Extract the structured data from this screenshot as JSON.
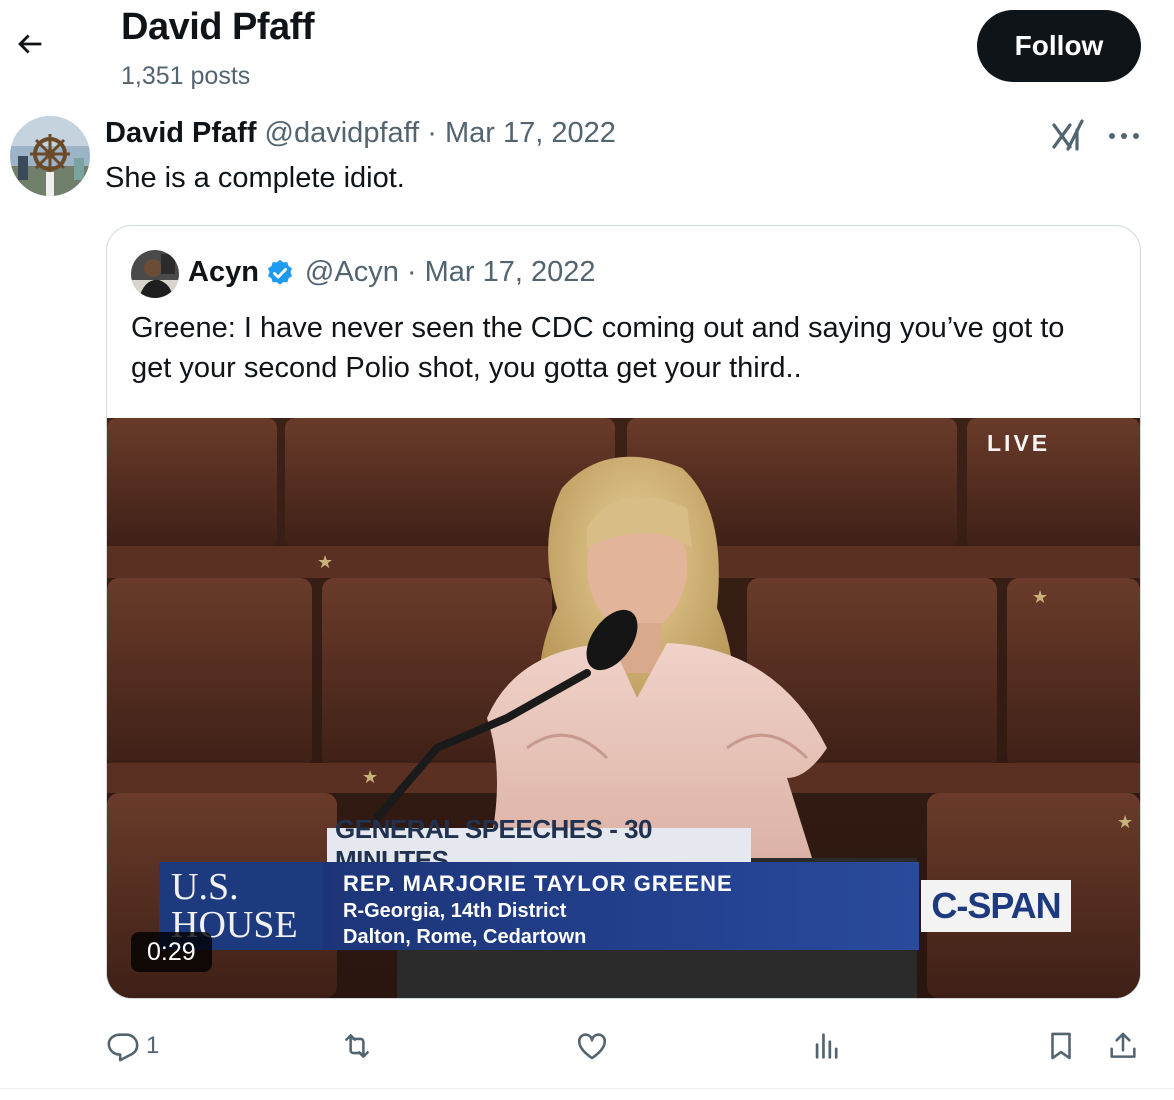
{
  "header": {
    "name": "David Pfaff",
    "posts": "1,351 posts",
    "follow_label": "Follow"
  },
  "post": {
    "author": "David Pfaff",
    "handle": "@davidpfaff",
    "separator": "·",
    "date": "Mar 17, 2022",
    "text": "She is a complete idiot."
  },
  "quote": {
    "author": "Acyn",
    "handle": "@Acyn",
    "separator": "·",
    "date": "Mar 17, 2022",
    "text_lines": [
      "Greene: I have never seen the CDC coming out and saying you’ve got to",
      "get your second Polio shot, you gotta get your third.."
    ],
    "video": {
      "live": "LIVE",
      "segment_title": "GENERAL SPEECHES - 30 MINUTES",
      "speaker": "REP. MARJORIE TAYLOR GREENE",
      "district": "R-Georgia, 14th District",
      "towns": "Dalton, Rome, Cedartown",
      "house_logo_line1": "U.S.",
      "house_logo_line2": "HOUSE",
      "network": "C-SPAN",
      "duration": "0:29"
    }
  },
  "actions": {
    "reply_count": "1"
  },
  "colors": {
    "text_primary": "#0f1419",
    "text_secondary": "#536471",
    "verified_blue": "#1d9bf0",
    "border": "#cfd9de"
  },
  "icons": [
    "back-arrow-icon",
    "grok-icon",
    "more-icon",
    "verified-badge-icon",
    "reply-icon",
    "repost-icon",
    "like-icon",
    "views-icon",
    "bookmark-icon",
    "share-icon"
  ]
}
